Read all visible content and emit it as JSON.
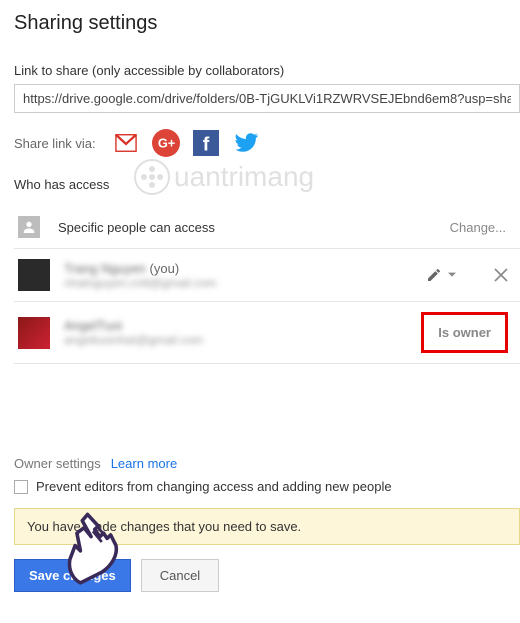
{
  "title": "Sharing settings",
  "linkLabel": "Link to share (only accessible by collaborators)",
  "linkValue": "https://drive.google.com/drive/folders/0B-TjGUKLVi1RZWRVSEJEbnd6em8?usp=sha",
  "shareViaLabel": "Share link via:",
  "whoHeading": "Who has access",
  "watermark": "uantrimang",
  "accessSummary": "Specific people can access",
  "changeLabel": "Change...",
  "people": [
    {
      "name": "Trang Nguyen",
      "youSuffix": " (you)",
      "email": "nhatnguyen.cntt@gmail.com",
      "role": "editor"
    },
    {
      "name": "AngelTuoi",
      "youSuffix": "",
      "email": "angeltuoinhat@gmail.com",
      "role": "owner"
    }
  ],
  "ownerBadge": "Is owner",
  "ownerSettingsLabel": "Owner settings",
  "learnMore": "Learn more",
  "preventEditorsLabel": "Prevent editors from changing access and adding new people",
  "noticeText": "You have made changes that you need to save.",
  "saveLabel": "Save changes",
  "cancelLabel": "Cancel"
}
